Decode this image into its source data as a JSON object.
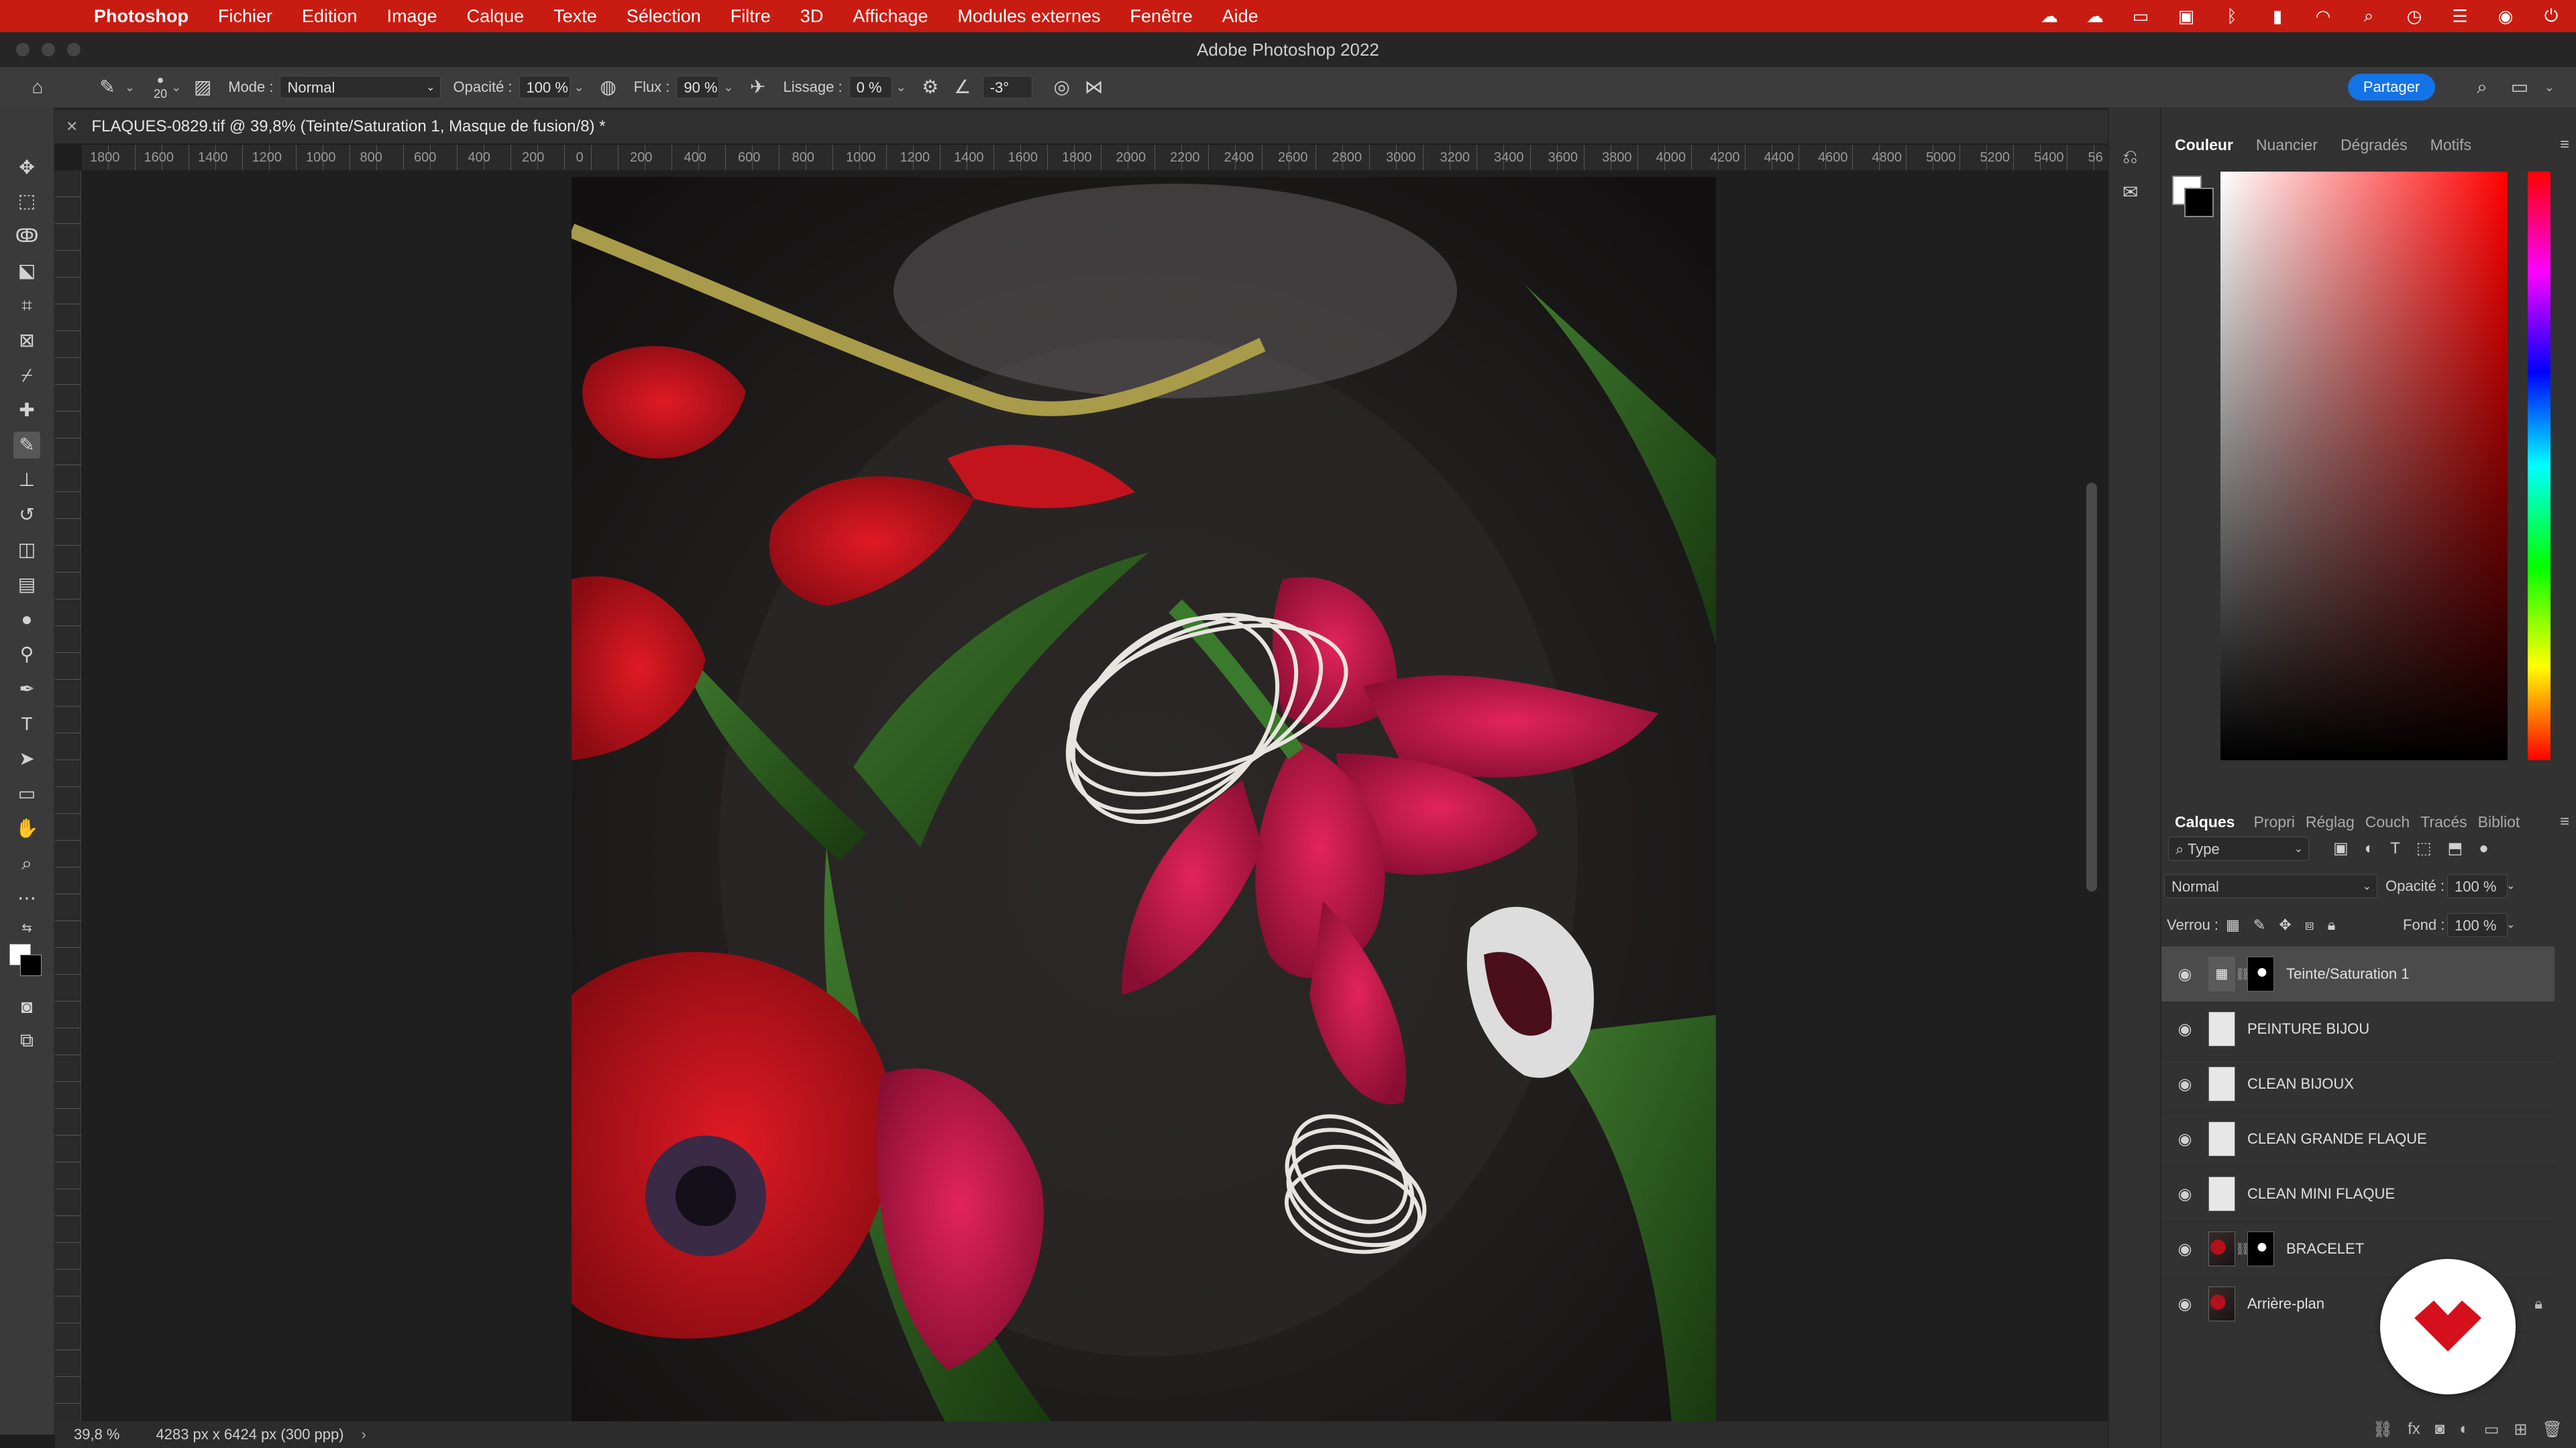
{
  "menubar": {
    "app": "Photoshop",
    "items": [
      "Fichier",
      "Edition",
      "Image",
      "Calque",
      "Texte",
      "Sélection",
      "Filtre",
      "3D",
      "Affichage",
      "Modules externes",
      "Fenêtre",
      "Aide"
    ]
  },
  "window": {
    "title": "Adobe Photoshop 2022"
  },
  "options": {
    "brush_size": "20",
    "mode_label": "Mode :",
    "mode_value": "Normal",
    "opacity_label": "Opacité :",
    "opacity_value": "100 %",
    "flow_label": "Flux :",
    "flow_value": "90 %",
    "smoothing_label": "Lissage :",
    "smoothing_value": "0 %",
    "angle_value": "-3°",
    "share_label": "Partager"
  },
  "document": {
    "tab_title": "FLAQUES-0829.tif @ 39,8% (Teinte/Saturation 1, Masque de fusion/8) *",
    "ruler_ticks": [
      "1800",
      "1600",
      "1400",
      "1200",
      "1000",
      "800",
      "600",
      "400",
      "200",
      "0",
      "200",
      "400",
      "600",
      "800",
      "1000",
      "1200",
      "1400",
      "1600",
      "1800",
      "2000",
      "2200",
      "2400",
      "2600",
      "2800",
      "3000",
      "3200",
      "3400",
      "3600",
      "3800",
      "4000",
      "4200",
      "4400",
      "4600",
      "4800",
      "5000",
      "5200",
      "5400",
      "56"
    ]
  },
  "status": {
    "zoom": "39,8 %",
    "size": "4283 px x 6424 px (300 ppp)",
    "arrow": "›"
  },
  "color_panel": {
    "tabs": [
      "Couleur",
      "Nuancier",
      "Dégradés",
      "Motifs"
    ],
    "active_tab": "Couleur",
    "foreground": "#ffffff",
    "background": "#000000"
  },
  "layers_panel": {
    "tabs": [
      "Calques",
      "Propri",
      "Réglag",
      "Couch",
      "Tracés",
      "Bibliot"
    ],
    "active_tab": "Calques",
    "filter_value": "Type",
    "blend_mode": "Normal",
    "opacity_label": "Opacité :",
    "opacity_value": "100 %",
    "lock_label": "Verrou :",
    "fill_label": "Fond :",
    "fill_value": "100 %",
    "layers": [
      {
        "name": "Teinte/Saturation 1",
        "selected": true
      },
      {
        "name": "PEINTURE BIJOU"
      },
      {
        "name": "CLEAN BIJOUX"
      },
      {
        "name": "CLEAN GRANDE FLAQUE"
      },
      {
        "name": "CLEAN MINI FLAQUE"
      },
      {
        "name": "BRACELET"
      },
      {
        "name": "Arrière-plan"
      }
    ]
  }
}
